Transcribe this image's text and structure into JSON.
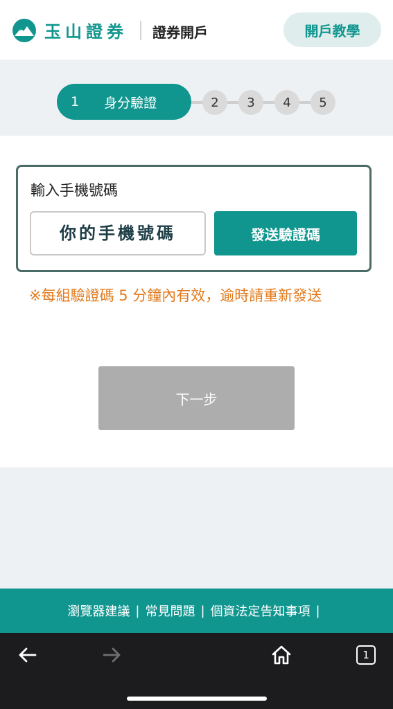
{
  "header": {
    "brand": "玉山證券",
    "title": "證券開戶",
    "tutorial_label": "開戶教學"
  },
  "stepper": {
    "active": {
      "number": "1",
      "label": "身分驗證"
    },
    "steps": [
      "2",
      "3",
      "4",
      "5"
    ]
  },
  "phone": {
    "label": "輸入手機號碼",
    "placeholder": "你的手機號碼",
    "send_label": "發送驗證碼"
  },
  "notice": "※每組驗證碼 5 分鐘內有效，逾時請重新發送",
  "next_label": "下一步",
  "footer": {
    "links": [
      "瀏覽器建議",
      "常見問題",
      "個資法定告知事項"
    ],
    "separator": "|"
  },
  "browser": {
    "tab_count": "1",
    "icons": [
      "back-arrow-icon",
      "forward-arrow-icon",
      "home-icon",
      "tabs-icon"
    ]
  },
  "colors": {
    "brand": "#11968f",
    "notice": "#e27a1c",
    "disabled": "#adadad"
  }
}
